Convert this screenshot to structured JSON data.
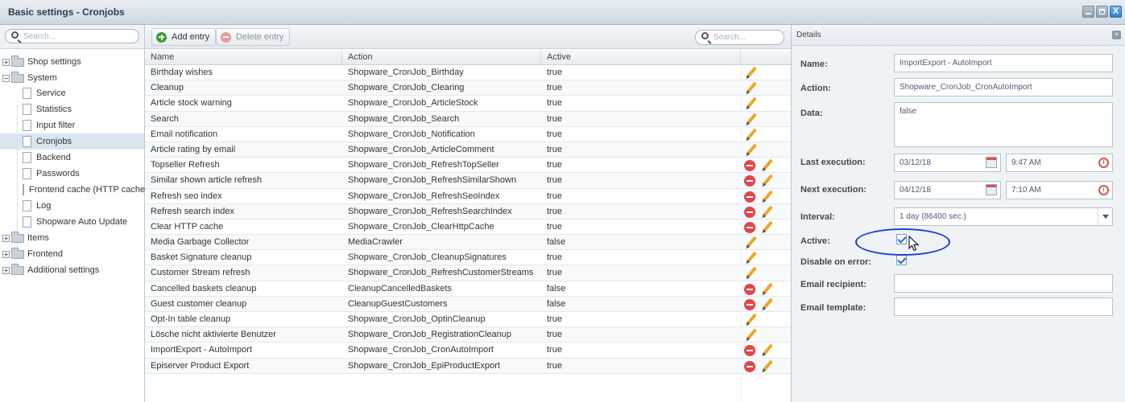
{
  "window": {
    "title": "Basic settings - Cronjobs",
    "close_glyph": "X"
  },
  "tree": {
    "search_placeholder": "Search...",
    "items": [
      {
        "label": "Shop settings",
        "type": "folder",
        "expander": "+"
      },
      {
        "label": "System",
        "type": "folder",
        "expander": "−"
      },
      {
        "label": "Service",
        "type": "leaf"
      },
      {
        "label": "Statistics",
        "type": "leaf"
      },
      {
        "label": "Input filter",
        "type": "leaf"
      },
      {
        "label": "Cronjobs",
        "type": "leaf",
        "selected": true
      },
      {
        "label": "Backend",
        "type": "leaf"
      },
      {
        "label": "Passwords",
        "type": "leaf"
      },
      {
        "label": "Frontend cache (HTTP cache)",
        "type": "leaf"
      },
      {
        "label": "Log",
        "type": "leaf"
      },
      {
        "label": "Shopware Auto Update",
        "type": "leaf"
      },
      {
        "label": "Items",
        "type": "folder",
        "expander": "+"
      },
      {
        "label": "Frontend",
        "type": "folder",
        "expander": "+"
      },
      {
        "label": "Additional settings",
        "type": "folder",
        "expander": "+"
      }
    ]
  },
  "toolbar": {
    "add_label": "Add entry",
    "delete_label": "Delete entry",
    "search_placeholder": "Search..."
  },
  "grid": {
    "columns": [
      "Name",
      "Action",
      "Active"
    ],
    "rows": [
      {
        "name": "Birthday wishes",
        "action": "Shopware_CronJob_Birthday",
        "active": "true",
        "deletable": false
      },
      {
        "name": "Cleanup",
        "action": "Shopware_CronJob_Clearing",
        "active": "true",
        "deletable": false
      },
      {
        "name": "Article stock warning",
        "action": "Shopware_CronJob_ArticleStock",
        "active": "true",
        "deletable": false
      },
      {
        "name": "Search",
        "action": "Shopware_CronJob_Search",
        "active": "true",
        "deletable": false
      },
      {
        "name": "Email notification",
        "action": "Shopware_CronJob_Notification",
        "active": "true",
        "deletable": false
      },
      {
        "name": "Article rating by email",
        "action": "Shopware_CronJob_ArticleComment",
        "active": "true",
        "deletable": false
      },
      {
        "name": "Topseller Refresh",
        "action": "Shopware_CronJob_RefreshTopSeller",
        "active": "true",
        "deletable": true
      },
      {
        "name": "Similar shown article refresh",
        "action": "Shopware_CronJob_RefreshSimilarShown",
        "active": "true",
        "deletable": true
      },
      {
        "name": "Refresh seo index",
        "action": "Shopware_CronJob_RefreshSeoIndex",
        "active": "true",
        "deletable": true
      },
      {
        "name": "Refresh search index",
        "action": "Shopware_CronJob_RefreshSearchIndex",
        "active": "true",
        "deletable": true
      },
      {
        "name": "Clear HTTP cache",
        "action": "Shopware_CronJob_ClearHttpCache",
        "active": "true",
        "deletable": true
      },
      {
        "name": "Media Garbage Collector",
        "action": "MediaCrawler",
        "active": "false",
        "deletable": false
      },
      {
        "name": "Basket Signature cleanup",
        "action": "Shopware_CronJob_CleanupSignatures",
        "active": "true",
        "deletable": false
      },
      {
        "name": "Customer Stream refresh",
        "action": "Shopware_CronJob_RefreshCustomerStreams",
        "active": "true",
        "deletable": false
      },
      {
        "name": "Cancelled baskets cleanup",
        "action": "CleanupCancelledBaskets",
        "active": "false",
        "deletable": true
      },
      {
        "name": "Guest customer cleanup",
        "action": "CleanupGuestCustomers",
        "active": "false",
        "deletable": true
      },
      {
        "name": "Opt-In table cleanup",
        "action": "Shopware_CronJob_OptinCleanup",
        "active": "true",
        "deletable": false
      },
      {
        "name": "Lösche nicht aktivierte Benutzer",
        "action": "Shopware_CronJob_RegistrationCleanup",
        "active": "true",
        "deletable": false
      },
      {
        "name": "ImportExport - AutoImport",
        "action": "Shopware_CronJob_CronAutoImport",
        "active": "true",
        "deletable": true
      },
      {
        "name": "Episerver Product Export",
        "action": "Shopware_CronJob_EpiProductExport",
        "active": "true",
        "deletable": true
      }
    ]
  },
  "details": {
    "title": "Details",
    "collapse_glyph": "»",
    "name_label": "Name:",
    "name_value": "ImportExport - AutoImport",
    "action_label": "Action:",
    "action_value": "Shopware_CronJob_CronAutoImport",
    "data_label": "Data:",
    "data_value": "false",
    "last_label": "Last execution:",
    "last_date": "03/12/18",
    "last_time": "9:47 AM",
    "next_label": "Next execution:",
    "next_date": "04/12/18",
    "next_time": "7:10 AM",
    "interval_label": "Interval:",
    "interval_value": "1 day (86400 sec.)",
    "active_label": "Active:",
    "active_checked": true,
    "disable_label": "Disable on error:",
    "disable_checked": true,
    "email_recipient_label": "Email recipient:",
    "email_recipient_value": "",
    "email_template_label": "Email template:",
    "email_template_value": ""
  },
  "colors": {
    "highlight_ellipse": "#1a3fd4",
    "delete_red": "#e0464b",
    "edit_orange": "#e59b1c",
    "selected_row": "#d8e6f2"
  }
}
